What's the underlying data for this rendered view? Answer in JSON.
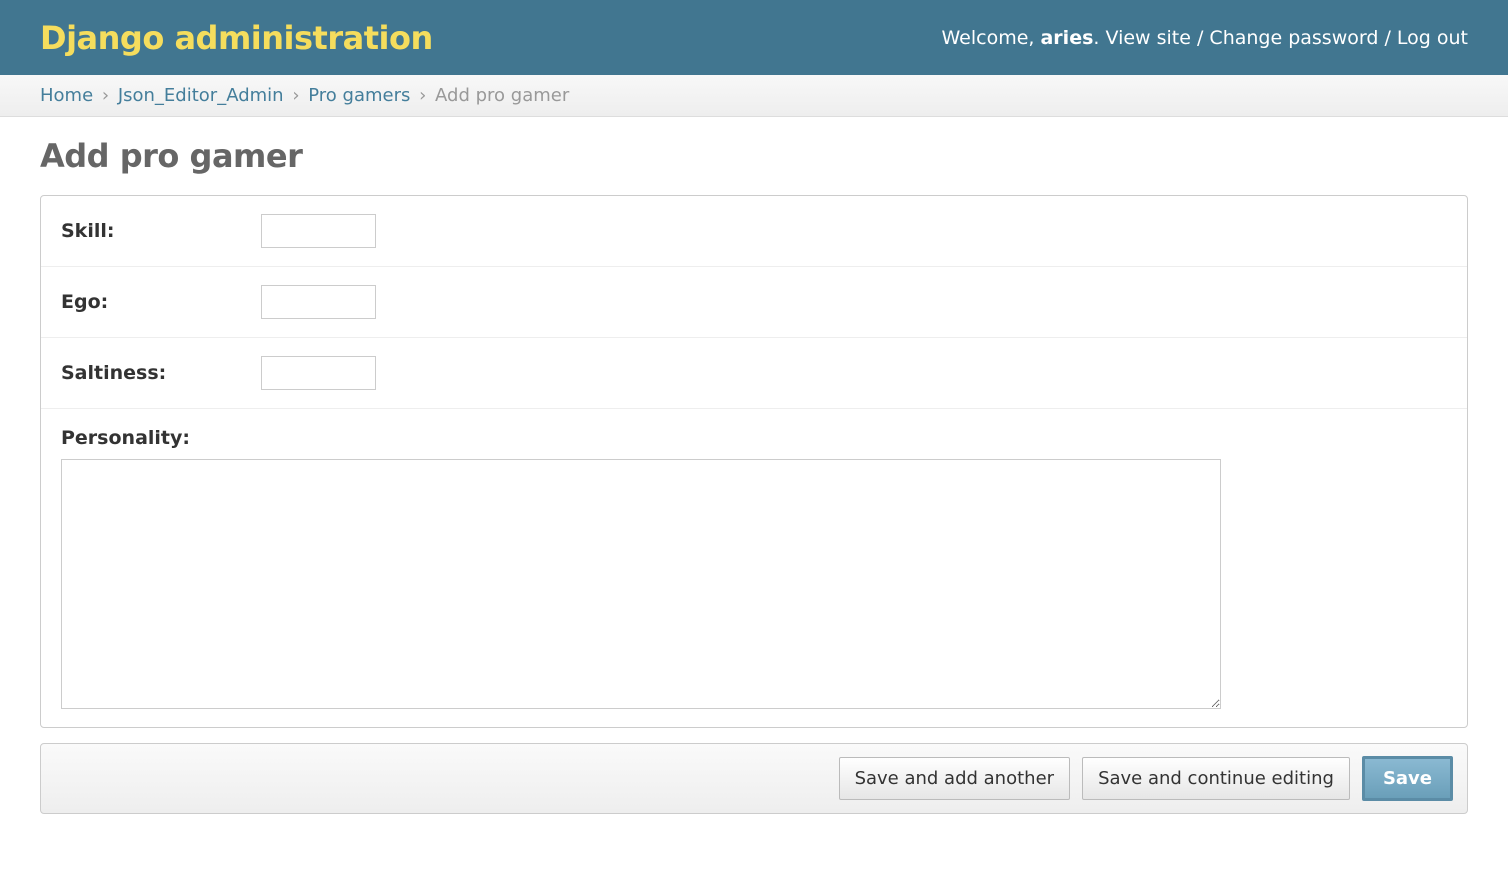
{
  "header": {
    "branding": "Django administration",
    "welcome_text": "Welcome, ",
    "username": "aries",
    "period": ". ",
    "view_site": "View site",
    "change_password": "Change password",
    "log_out": "Log out",
    "separator": " / "
  },
  "breadcrumbs": {
    "home": "Home",
    "app": "Json_Editor_Admin",
    "model": "Pro gamers",
    "current": "Add pro gamer",
    "separator": "›"
  },
  "content": {
    "title": "Add pro gamer"
  },
  "form": {
    "fields": {
      "skill": {
        "label": "Skill:",
        "value": ""
      },
      "ego": {
        "label": "Ego:",
        "value": ""
      },
      "saltiness": {
        "label": "Saltiness:",
        "value": ""
      },
      "personality": {
        "label": "Personality:",
        "value": ""
      }
    }
  },
  "buttons": {
    "save_add_another": "Save and add another",
    "save_continue": "Save and continue editing",
    "save": "Save"
  }
}
